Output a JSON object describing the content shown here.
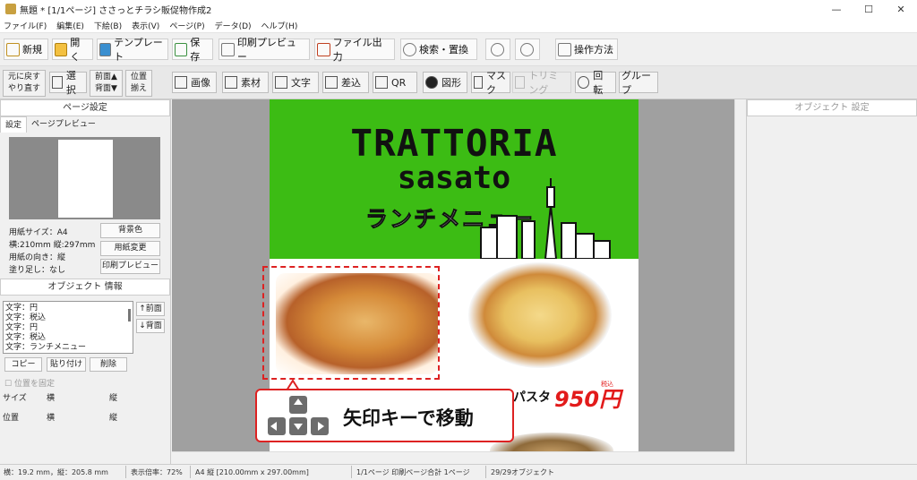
{
  "window": {
    "title": "無題 * [1/1ページ] ささっとチラシ販促物作成2",
    "controls": [
      "—",
      "☐",
      "✕"
    ]
  },
  "menu": [
    "ファイル(F)",
    "編集(E)",
    "下絵(B)",
    "表示(V)",
    "ページ(P)",
    "データ(D)",
    "ヘルプ(H)"
  ],
  "toolbar": {
    "new": "新規",
    "open": "開く",
    "template": "テンプレート",
    "save": "保存",
    "print_preview": "印刷プレビュー",
    "file_output": "ファイル出力",
    "search_replace": "検索・置換",
    "how_to": "操作方法"
  },
  "toolbar2": {
    "undo": "元に戻す",
    "redo": "やり直す",
    "select": "選択",
    "front": "前面▲",
    "back": "背面▼",
    "align1": "位置",
    "align2": "揃え",
    "image": "画像",
    "material": "素材",
    "text": "文字",
    "merge": "差込",
    "qr": "QR",
    "shape": "図形",
    "mask": "マスク",
    "trim": "トリミング",
    "rotate": "回転",
    "group": "グループ"
  },
  "page_settings": {
    "header": "ページ設定",
    "tab_settings": "設定",
    "tab_preview": "ページプレビュー",
    "paper_size": "用紙サイズ：A4",
    "dims": "横:210mm 縦:297mm",
    "orientation": "用紙の向き：縦",
    "bleed": "塗り足し：なし",
    "bg_color": "背景色",
    "change_paper": "用紙変更",
    "print_preview": "印刷プレビュー"
  },
  "object_info": {
    "header": "オブジェクト 情報",
    "items": [
      "文字：円",
      "文字：税込",
      "文字：円",
      "文字：税込",
      "文字：ランチメニュー"
    ],
    "front": "↑前面",
    "back": "↓背面",
    "copy": "コピー",
    "paste": "貼り付け",
    "delete": "削除",
    "lock": "位置を固定",
    "size_label": "サイズ",
    "pos_label": "位置",
    "w_label": "横",
    "h_label": "縦"
  },
  "object_settings": {
    "header": "オブジェクト 設定"
  },
  "flyer": {
    "title": "TRATTORIA",
    "subtitle": "sasato",
    "menu_heading": "ランチメニュー",
    "pasta_label": "パスタ",
    "pasta_price": "950円",
    "tax_note": "税込"
  },
  "callout": {
    "text": "矢印キーで移動"
  },
  "status": {
    "coords": "横：19.2 mm，縦：205.8 mm",
    "zoom": "表示倍率：72%",
    "paper": "A4 縦 [210.00mm x 297.00mm]",
    "pages": "1/1ページ 印刷ページ合計 1ページ",
    "objects": "29/29オブジェクト"
  },
  "colors": {
    "banner": "#3cbc14",
    "price": "#e21b1b",
    "selection": "#dd2222"
  }
}
